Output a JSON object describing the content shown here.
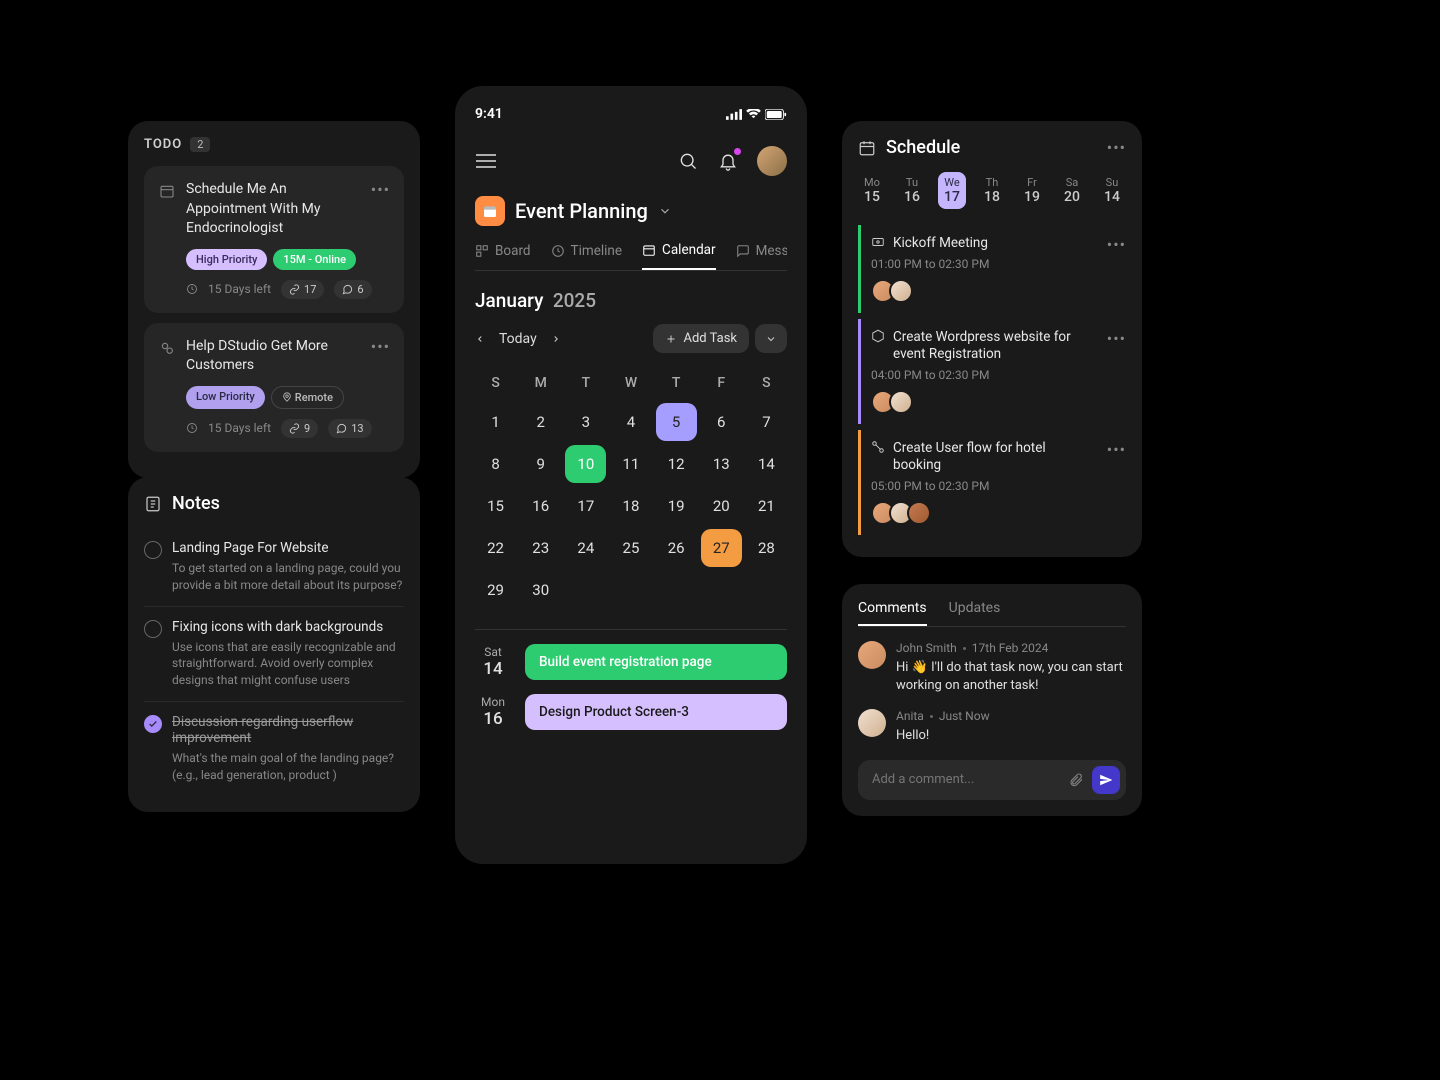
{
  "todo": {
    "title": "TODO",
    "count": "2",
    "items": [
      {
        "text": "Schedule Me An Appointment With My Endocrinologist",
        "priority": "High Priority",
        "tag2": "15M - Online",
        "days": "15 Days left",
        "links": "17",
        "comments": "6"
      },
      {
        "text": "Help DStudio Get More Customers",
        "priority": "Low Priority",
        "tag2": "Remote",
        "days": "15 Days left",
        "links": "9",
        "comments": "13"
      }
    ]
  },
  "notes": {
    "title": "Notes",
    "items": [
      {
        "title": "Landing Page For Website",
        "desc": "To get started on a landing page, could you provide a bit more detail about its purpose?",
        "done": false
      },
      {
        "title": "Fixing icons with dark backgrounds",
        "desc": "Use icons that are easily recognizable and straightforward. Avoid overly complex designs that might confuse users",
        "done": false
      },
      {
        "title": "Discussion regarding userflow improvement",
        "desc": "What's the main goal of the landing page? (e.g., lead generation, product )",
        "done": true
      }
    ]
  },
  "phone": {
    "time": "9:41",
    "planTitle": "Event Planning",
    "tabs": [
      "Board",
      "Timeline",
      "Calendar",
      "Messa"
    ],
    "month": "January",
    "year": "2025",
    "today": "Today",
    "addTask": "Add Task",
    "dayHeads": [
      "S",
      "M",
      "T",
      "W",
      "T",
      "F",
      "S"
    ],
    "weeks": [
      [
        "",
        "1",
        "2",
        "3",
        "4",
        "5",
        "6",
        "7"
      ],
      [
        "8",
        "9",
        "10",
        "11",
        "12",
        "13",
        "14"
      ],
      [
        "15",
        "16",
        "17",
        "18",
        "19",
        "20",
        "21"
      ],
      [
        "22",
        "23",
        "24",
        "25",
        "26",
        "27",
        "28"
      ],
      [
        "29",
        "30",
        "",
        "",
        "",
        "",
        ""
      ]
    ],
    "events": [
      {
        "dow": "Sat",
        "num": "14",
        "text": "Build event registration page",
        "cls": "bar-green"
      },
      {
        "dow": "Mon",
        "num": "16",
        "text": "Design Product Screen-3",
        "cls": "bar-purple"
      }
    ]
  },
  "schedule": {
    "title": "Schedule",
    "week": [
      {
        "d": "Mo",
        "n": "15"
      },
      {
        "d": "Tu",
        "n": "16"
      },
      {
        "d": "We",
        "n": "17"
      },
      {
        "d": "Th",
        "n": "18"
      },
      {
        "d": "Fr",
        "n": "19"
      },
      {
        "d": "Sa",
        "n": "20"
      },
      {
        "d": "Su",
        "n": "14"
      }
    ],
    "items": [
      {
        "title": "Kickoff Meeting",
        "time": "01:00 PM to 02:30 PM",
        "cls": "sched-green"
      },
      {
        "title": "Create Wordpress website for event Registration",
        "time": "04:00 PM to 02:30 PM",
        "cls": "sched-purple"
      },
      {
        "title": "Create User flow for hotel booking",
        "time": "05:00 PM to 02:30 PM",
        "cls": "sched-orange"
      }
    ]
  },
  "comments": {
    "tabs": [
      "Comments",
      "Updates"
    ],
    "list": [
      {
        "name": "John Smith",
        "when": "17th Feb 2024",
        "text": "Hi 👋 I'll do that task now, you can start working on another task!"
      },
      {
        "name": "Anita",
        "when": "Just Now",
        "text": "Hello!"
      }
    ],
    "placeholder": "Add a comment..."
  }
}
